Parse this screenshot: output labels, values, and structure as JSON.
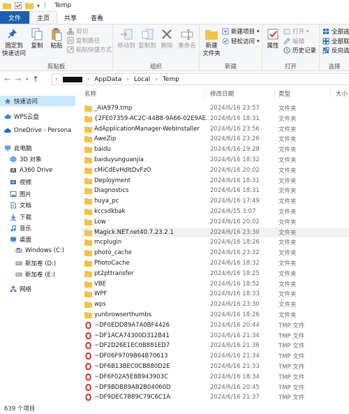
{
  "window": {
    "title": "Temp"
  },
  "ribbon_tabs": [
    "文件",
    "主页",
    "共享",
    "查看"
  ],
  "ribbon": {
    "clipboard": {
      "pin_label": "固定到\n快速访问",
      "copy_label": "复制",
      "paste_label": "粘贴",
      "cut_label": "剪切",
      "copy_path_label": "复制路径",
      "paste_shortcut_label": "粘贴快捷方式",
      "group_label": "剪贴板"
    },
    "organize": {
      "move_to_label": "移动到",
      "copy_to_label": "复制到",
      "delete_label": "删除",
      "rename_label": "重命名",
      "group_label": "组织"
    },
    "new": {
      "new_folder_label": "新建\n文件夹",
      "new_item_label": "新建项目",
      "easy_access_label": "轻松访问",
      "group_label": "新建"
    },
    "open": {
      "properties_label": "属性",
      "open_label": "打开",
      "edit_label": "编辑",
      "history_label": "历史记录",
      "group_label": "打开"
    },
    "select": {
      "select_all_label": "全部选",
      "select_none_label": "全部取",
      "invert_label": "反向选",
      "group_label": "选择"
    }
  },
  "address": {
    "crumbs": [
      "AppData",
      "Local",
      "Temp"
    ]
  },
  "nav": {
    "items": [
      {
        "label": "快速访问",
        "icon": "star-icon",
        "selected": true
      },
      {
        "label": "WPS云盘",
        "icon": "cloud-icon"
      },
      {
        "label": "OneDrive - Persona",
        "icon": "onedrive-icon"
      },
      {
        "label": "此电脑",
        "icon": "pc-icon"
      },
      {
        "label": "3D 对象",
        "icon": "cube-icon"
      },
      {
        "label": "A360 Drive",
        "icon": "a360-icon"
      },
      {
        "label": "视频",
        "icon": "video-icon"
      },
      {
        "label": "图片",
        "icon": "picture-icon"
      },
      {
        "label": "文档",
        "icon": "document-icon"
      },
      {
        "label": "下载",
        "icon": "download-icon"
      },
      {
        "label": "音乐",
        "icon": "music-icon"
      },
      {
        "label": "桌面",
        "icon": "desktop-icon"
      },
      {
        "label": "Windows  (C:)",
        "icon": "drive-c-icon"
      },
      {
        "label": "新加卷 (D:)",
        "icon": "drive-icon"
      },
      {
        "label": "新加卷 (E:)",
        "icon": "drive-icon"
      },
      {
        "label": "网络",
        "icon": "network-icon"
      }
    ]
  },
  "columns": {
    "name": "名称",
    "date": "修改日期",
    "type": "类型",
    "size": "大小"
  },
  "files": [
    {
      "name": "_AIA979.tmp",
      "date": "2024/6/16 23:57",
      "type": "文件夹",
      "kind": "folder"
    },
    {
      "name": "{2FE07359-AC2C-44B8-9A66-02E9AE...",
      "date": "2024/6/16 18:31",
      "type": "文件夹",
      "kind": "folder"
    },
    {
      "name": "AdApplicationManager-WebInstaller",
      "date": "2024/6/16 23:56",
      "type": "文件夹",
      "kind": "folder"
    },
    {
      "name": "AweZip",
      "date": "2024/6/16 23:26",
      "type": "文件夹",
      "kind": "folder"
    },
    {
      "name": "baidu",
      "date": "2024/6/16 19:28",
      "type": "文件夹",
      "kind": "folder"
    },
    {
      "name": "baiduyunguanjia",
      "date": "2024/6/16 18:32",
      "type": "文件夹",
      "kind": "folder"
    },
    {
      "name": "cMiCdEvHdItDvFzO",
      "date": "2024/6/16 20:02",
      "type": "文件夹",
      "kind": "folder"
    },
    {
      "name": "Deployment",
      "date": "2024/6/16 18:31",
      "type": "文件夹",
      "kind": "folder"
    },
    {
      "name": "Diagnostics",
      "date": "2024/6/16 18:31",
      "type": "文件夹",
      "kind": "folder"
    },
    {
      "name": "huya_pc",
      "date": "2024/6/16 17:49",
      "type": "文件夹",
      "kind": "folder"
    },
    {
      "name": "kccsdkbak",
      "date": "2024/6/15 3:07",
      "type": "文件夹",
      "kind": "folder"
    },
    {
      "name": "Low",
      "date": "2024/6/16 20:02",
      "type": "文件夹",
      "kind": "folder"
    },
    {
      "name": "Magick.NET.net40.7.23.2.1",
      "date": "2024/6/16 23:30",
      "type": "文件夹",
      "kind": "folder",
      "highlight": true
    },
    {
      "name": "mcplugin",
      "date": "2024/6/16 18:26",
      "type": "文件夹",
      "kind": "folder"
    },
    {
      "name": "photo_cache",
      "date": "2024/6/16 23:32",
      "type": "文件夹",
      "kind": "folder"
    },
    {
      "name": "PhotoCache",
      "date": "2024/6/16 18:32",
      "type": "文件夹",
      "kind": "folder"
    },
    {
      "name": "pt2pttransfer",
      "date": "2024/6/16 18:25",
      "type": "文件夹",
      "kind": "folder"
    },
    {
      "name": "VBE",
      "date": "2024/6/16 18:52",
      "type": "文件夹",
      "kind": "folder"
    },
    {
      "name": "WPF",
      "date": "2024/6/16 18:33",
      "type": "文件夹",
      "kind": "folder"
    },
    {
      "name": "wps",
      "date": "2024/6/16 23:30",
      "type": "文件夹",
      "kind": "folder"
    },
    {
      "name": "yunbrowserthumbs",
      "date": "2024/6/16 18:26",
      "type": "文件夹",
      "kind": "folder"
    },
    {
      "name": "~DF0EDD89A7A0BF4426",
      "date": "2024/6/16 20:44",
      "type": "TMP 文件",
      "kind": "tmp"
    },
    {
      "name": "~DF1ACA74300D312B41",
      "date": "2024/6/16 21:34",
      "type": "TMP 文件",
      "kind": "tmp"
    },
    {
      "name": "~DF2D26E1EC0B881ED7",
      "date": "2024/6/16 21:36",
      "type": "TMP 文件",
      "kind": "tmp"
    },
    {
      "name": "~DF06F9709B64B70613",
      "date": "2024/6/16 21:34",
      "type": "TMP 文件",
      "kind": "tmp"
    },
    {
      "name": "~DF6B13BEC0CB880D2E",
      "date": "2024/6/16 21:33",
      "type": "TMP 文件",
      "kind": "tmp"
    },
    {
      "name": "~DF6F02A5E8B943903C",
      "date": "2024/6/16 18:34",
      "type": "TMP 文件",
      "kind": "tmp"
    },
    {
      "name": "~DF9BDB89AB2B04060D",
      "date": "2024/6/16 20:45",
      "type": "TMP 文件",
      "kind": "tmp"
    },
    {
      "name": "~DF9DEC7B89C79C6C1A",
      "date": "2024/6/16 21:37",
      "type": "TMP 文件",
      "kind": "tmp"
    }
  ],
  "status": {
    "count": "639 个项目"
  },
  "colors": {
    "file_tab": "#1a5fb4",
    "selected_nav": "#cce8ff",
    "folder": "#f2c24b",
    "tmp_icon": "#d0312d"
  }
}
